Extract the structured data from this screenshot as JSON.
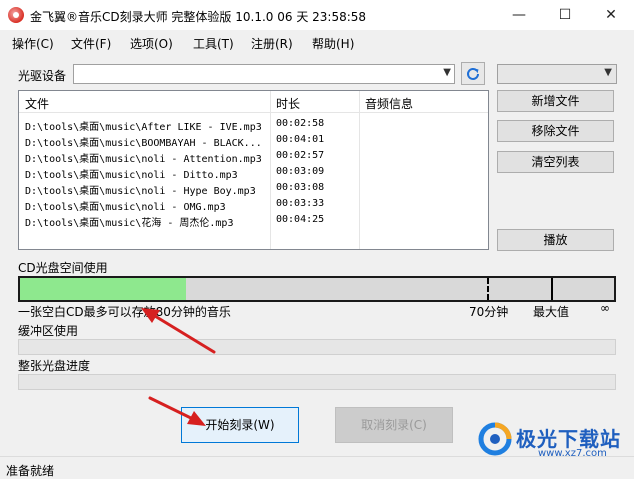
{
  "window": {
    "title": "金飞翼®音乐CD刻录大师 完整体验版 10.1.0 06 天 23:58:58",
    "minimize": "—",
    "maximize": "☐",
    "close": "✕"
  },
  "menu": [
    "操作(C)",
    "文件(F)",
    "选项(O)",
    "工具(T)",
    "注册(R)",
    "帮助(H)"
  ],
  "drive": {
    "label": "光驱设备",
    "value": "",
    "speed_value": ""
  },
  "filelist": {
    "columns": [
      "文件",
      "时长",
      "音频信息"
    ],
    "rows": [
      {
        "file": "D:\\tools\\桌面\\music\\After LIKE - IVE.mp3",
        "duration": "00:02:58",
        "info": ""
      },
      {
        "file": "D:\\tools\\桌面\\music\\BOOMBAYAH - BLACK...",
        "duration": "00:04:01",
        "info": ""
      },
      {
        "file": "D:\\tools\\桌面\\music\\noli - Attention.mp3",
        "duration": "00:02:57",
        "info": ""
      },
      {
        "file": "D:\\tools\\桌面\\music\\noli - Ditto.mp3",
        "duration": "00:03:09",
        "info": ""
      },
      {
        "file": "D:\\tools\\桌面\\music\\noli - Hype Boy.mp3",
        "duration": "00:03:08",
        "info": ""
      },
      {
        "file": "D:\\tools\\桌面\\music\\noli - OMG.mp3",
        "duration": "00:03:33",
        "info": ""
      },
      {
        "file": "D:\\tools\\桌面\\music\\花海 - 周杰伦.mp3",
        "duration": "00:04:25",
        "info": ""
      }
    ]
  },
  "side_buttons": {
    "add": "新增文件",
    "remove": "移除文件",
    "clear": "清空列表",
    "play": "播放"
  },
  "cd_space": {
    "label": "CD光盘空间使用",
    "used_fraction": 0.28,
    "note": "一张空白CD最多可以存放80分钟的音乐",
    "mark_80": "70分钟",
    "mark_max": "最大值",
    "mark_inf": "∞"
  },
  "buffer": {
    "label": "缓冲区使用",
    "fraction": 0
  },
  "progress": {
    "label": "整张光盘进度",
    "fraction": 0
  },
  "actions": {
    "burn": "开始刻录(W)",
    "cancel": "取消刻录(C)"
  },
  "status": "准备就绪",
  "watermark": {
    "name": "极光下载站",
    "url": "www.xz7.com"
  },
  "colors": {
    "cd_fill": "#8ee88e",
    "annotation_arrow": "#d62020",
    "focus_border": "#0078d7"
  }
}
